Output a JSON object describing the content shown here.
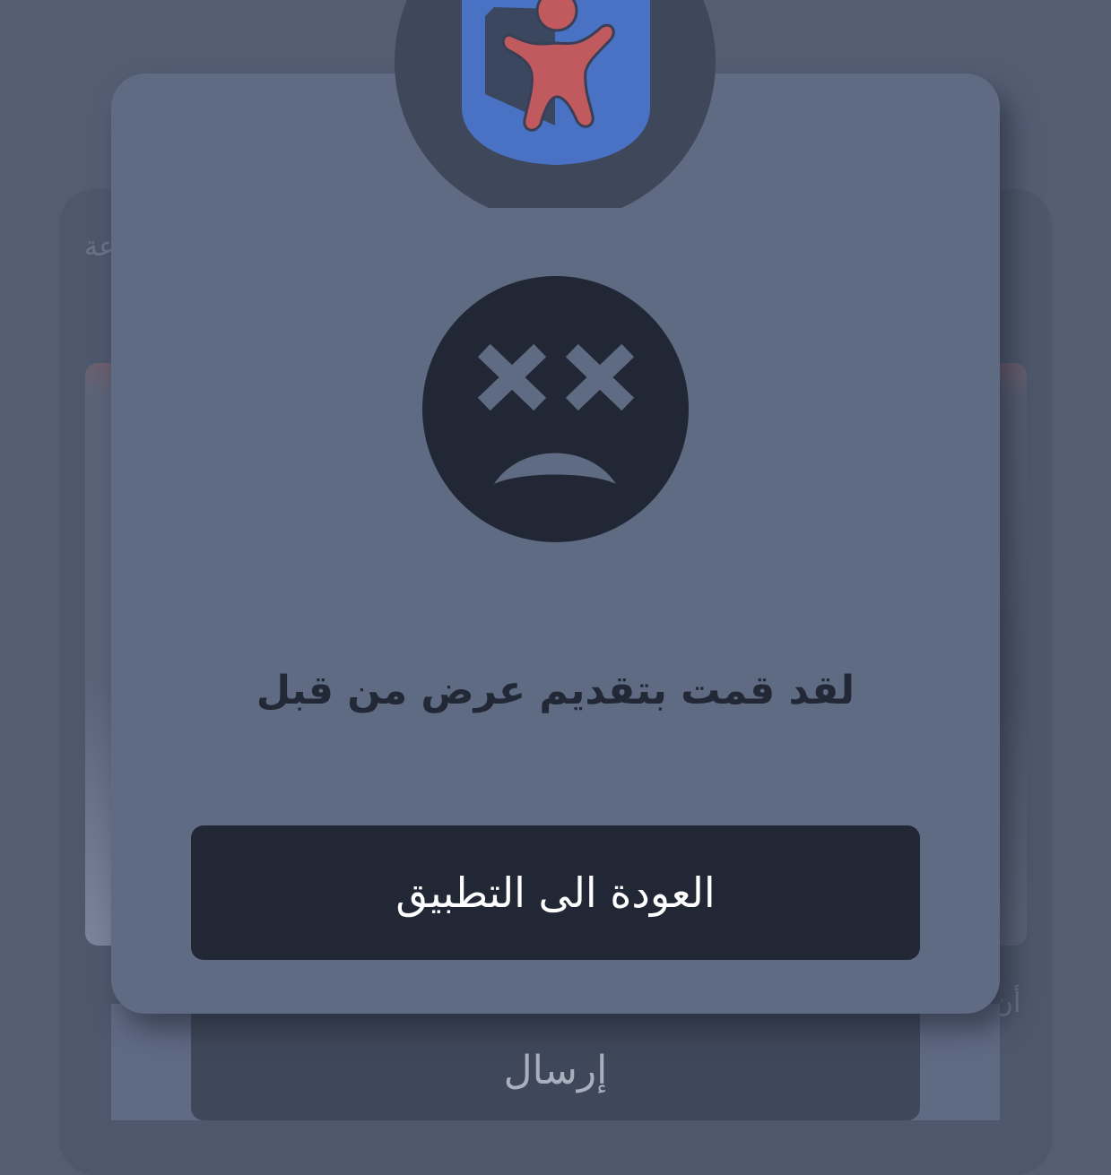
{
  "background": {
    "corner_text_left": "عة",
    "corner_text_right": "أن",
    "send_button_label": "إرسال"
  },
  "modal": {
    "message": "لقد قمت بتقديم عرض من قبل",
    "back_button_label": "العودة الى التطبيق"
  },
  "colors": {
    "overlay": "#545e73",
    "modal_bg": "#5f6a83",
    "button_bg": "#222736",
    "logo_shield": "#4a72c4",
    "logo_figure": "#c05a5e"
  },
  "icons": {
    "logo": "child-shield-logo-icon",
    "error": "sad-face-icon"
  }
}
